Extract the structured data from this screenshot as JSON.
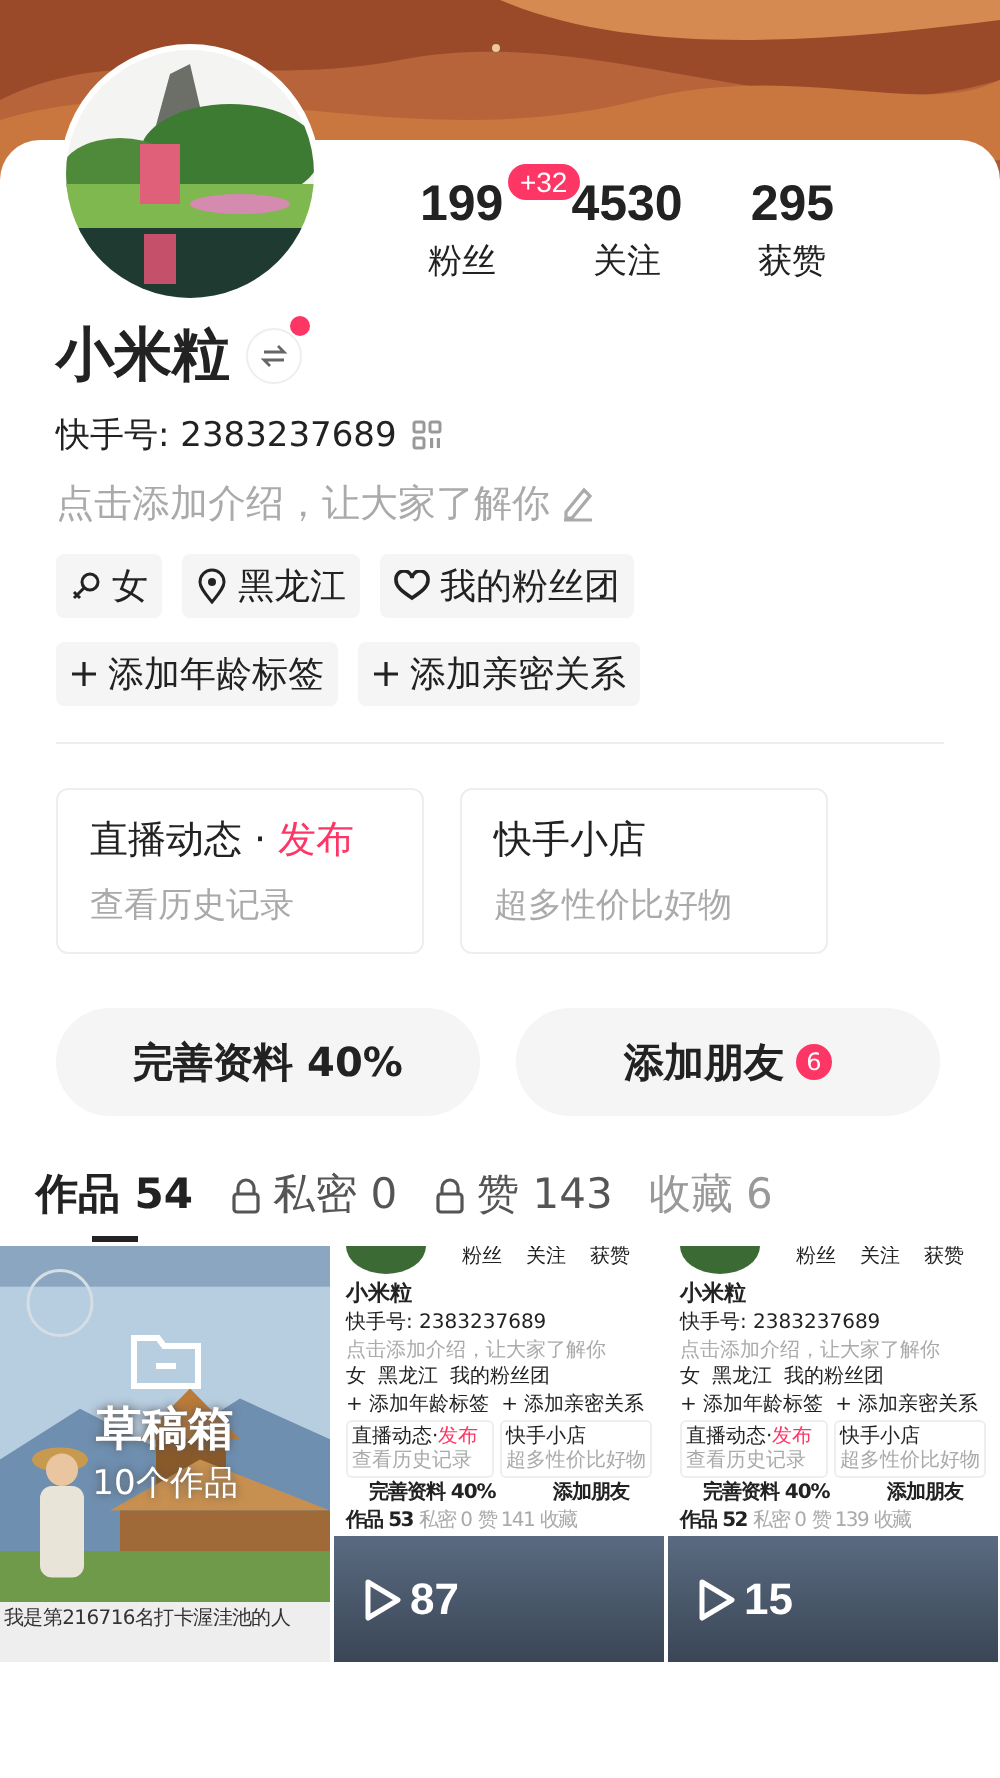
{
  "profile": {
    "stats": [
      {
        "value": "199",
        "label": "粉丝",
        "badge": "+32"
      },
      {
        "value": "4530",
        "label": "关注"
      },
      {
        "value": "295",
        "label": "获赞"
      }
    ],
    "name": "小米粒",
    "switch_notification": true,
    "id_text": "快手号: 2383237689",
    "intro_placeholder": "点击添加介绍，让大家了解你",
    "tags": [
      {
        "kind": "gender",
        "label": "女"
      },
      {
        "kind": "location",
        "label": "黑龙江"
      },
      {
        "kind": "fans",
        "label": "我的粉丝团"
      }
    ],
    "add_tags": [
      "添加年龄标签",
      "添加亲密关系"
    ],
    "cards": [
      {
        "title": "直播动态 ·",
        "action": "发布",
        "subtitle": "查看历史记录"
      },
      {
        "title": "快手小店",
        "subtitle": "超多性价比好物"
      }
    ],
    "buttons": [
      {
        "label": "完善资料 40%"
      },
      {
        "label": "添加朋友",
        "badge": "6"
      }
    ]
  },
  "tabs": [
    {
      "label": "作品 54",
      "locked": false,
      "selected": true
    },
    {
      "label": "私密 0",
      "locked": true,
      "selected": false
    },
    {
      "label": "赞 143",
      "locked": true,
      "selected": false
    },
    {
      "label": "收藏 6",
      "locked": false,
      "selected": false
    }
  ],
  "works": [
    {
      "kind": "draft",
      "title": "草稿箱",
      "count": "10个作品",
      "caption": "我是第216716名打卡渥洼池的人"
    },
    {
      "kind": "screenshot",
      "stat_labels": [
        "粉丝",
        "关注",
        "获赞"
      ],
      "name": "小米粒",
      "id_text": "快手号: 2383237689",
      "intro": "点击添加介绍，让大家了解你",
      "tags": [
        "女",
        "黑龙江",
        "我的粉丝团"
      ],
      "add_tags": [
        "+ 添加年龄标签",
        "+ 添加亲密关系"
      ],
      "cards": [
        {
          "title": "直播动态·",
          "action": "发布",
          "subtitle": "查看历史记录"
        },
        {
          "title": "快手小店",
          "subtitle": "超多性价比好物"
        }
      ],
      "buttons": [
        "完善资料 40%",
        "添加朋友"
      ],
      "tabs": [
        "作品 53",
        "私密 0",
        "赞 141",
        "收藏"
      ],
      "plays": "87"
    },
    {
      "kind": "screenshot",
      "stat_labels": [
        "粉丝",
        "关注",
        "获赞"
      ],
      "name": "小米粒",
      "id_text": "快手号: 2383237689",
      "intro": "点击添加介绍，让大家了解你",
      "tags": [
        "女",
        "黑龙江",
        "我的粉丝团"
      ],
      "add_tags": [
        "+ 添加年龄标签",
        "+ 添加亲密关系"
      ],
      "cards": [
        {
          "title": "直播动态·",
          "action": "发布",
          "subtitle": "查看历史记录"
        },
        {
          "title": "快手小店",
          "subtitle": "超多性价比好物"
        }
      ],
      "buttons": [
        "完善资料 40%",
        "添加朋友"
      ],
      "tabs": [
        "作品 52",
        "私密 0",
        "赞 139",
        "收藏"
      ],
      "plays": "15"
    }
  ]
}
